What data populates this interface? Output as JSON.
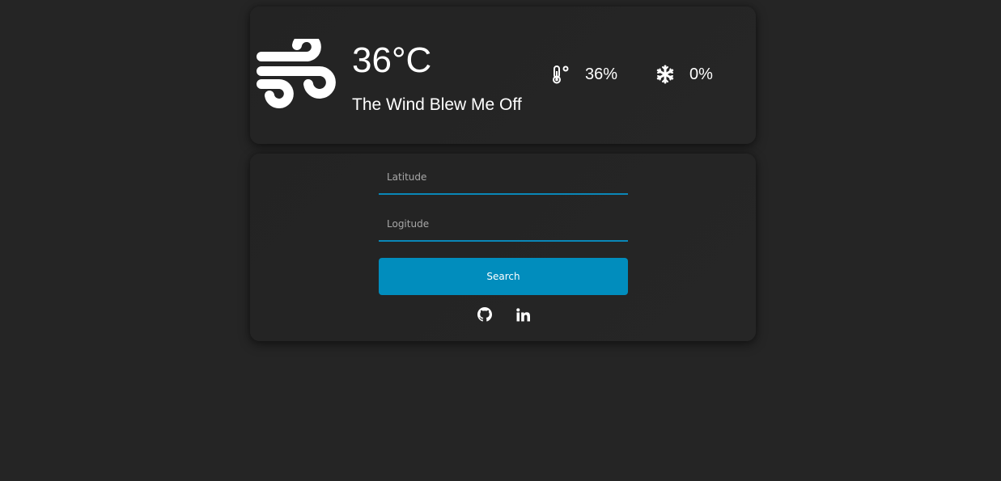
{
  "weather": {
    "icon": "wind-icon",
    "temperature": "36°C",
    "description": "The Wind Blew Me Off",
    "stats": [
      {
        "icon": "thermometer-icon",
        "value": "36%"
      },
      {
        "icon": "snowflake-icon",
        "value": "0%"
      }
    ]
  },
  "search": {
    "latitude_placeholder": "Latitude",
    "longitude_placeholder": "Logitude",
    "button_label": "Search"
  },
  "social": [
    {
      "icon": "github-icon"
    },
    {
      "icon": "linkedin-icon"
    }
  ],
  "colors": {
    "background": "#252525",
    "accent": "#018dbd",
    "underline": "#0a87b8",
    "text": "#ffffff"
  }
}
